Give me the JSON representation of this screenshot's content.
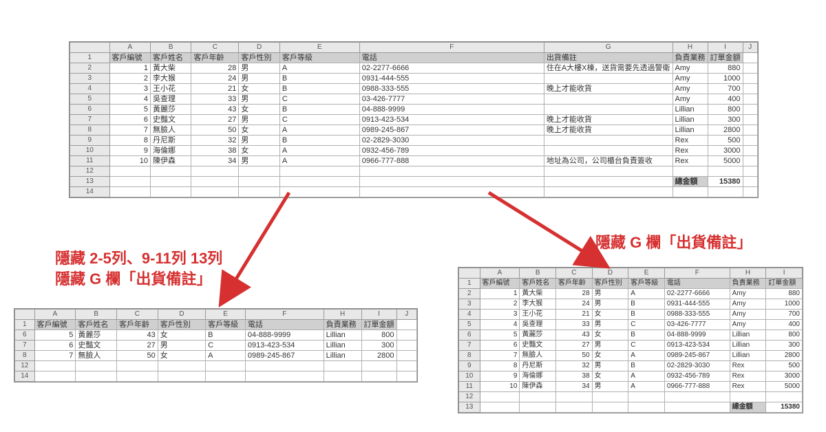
{
  "columns_full": [
    "A",
    "B",
    "C",
    "D",
    "E",
    "F",
    "G",
    "H",
    "I",
    "J"
  ],
  "columns_noG": [
    "A",
    "B",
    "C",
    "D",
    "E",
    "F",
    "H",
    "I",
    "J"
  ],
  "columns_noG2": [
    "A",
    "B",
    "C",
    "D",
    "E",
    "F",
    "H",
    "I"
  ],
  "headers_full": [
    "客戶編號",
    "客戶姓名",
    "客戶年齡",
    "客戶性別",
    "客戶等級",
    "電話",
    "出貨備註",
    "負責業務",
    "訂單金額",
    ""
  ],
  "headers_noG": [
    "客戶編號",
    "客戶姓名",
    "客戶年齡",
    "客戶性別",
    "客戶等級",
    "電話",
    "負責業務",
    "訂單金額",
    ""
  ],
  "headers_noG2": [
    "客戶編號",
    "客戶姓名",
    "客戶年齡",
    "客戶性別",
    "客戶等級",
    "電話",
    "負責業務",
    "訂單金額"
  ],
  "top_rows": [
    {
      "n": "2",
      "id": "1",
      "name": "黃大柴",
      "age": "28",
      "sex": "男",
      "grade": "A",
      "phone": "02-2277-6666",
      "note": "住在A大樓X棟，送貨需要先透過警衛",
      "rep": "Amy",
      "amt": "880"
    },
    {
      "n": "3",
      "id": "2",
      "name": "李大猴",
      "age": "24",
      "sex": "男",
      "grade": "B",
      "phone": "0931-444-555",
      "note": "",
      "rep": "Amy",
      "amt": "1000"
    },
    {
      "n": "4",
      "id": "3",
      "name": "王小花",
      "age": "21",
      "sex": "女",
      "grade": "B",
      "phone": "0988-333-555",
      "note": "晚上才能收貨",
      "rep": "Amy",
      "amt": "700"
    },
    {
      "n": "5",
      "id": "4",
      "name": "吳查理",
      "age": "33",
      "sex": "男",
      "grade": "C",
      "phone": "03-426-7777",
      "note": "",
      "rep": "Amy",
      "amt": "400"
    },
    {
      "n": "6",
      "id": "5",
      "name": "黃麗莎",
      "age": "43",
      "sex": "女",
      "grade": "B",
      "phone": "04-888-9999",
      "note": "",
      "rep": "Lillian",
      "amt": "800"
    },
    {
      "n": "7",
      "id": "6",
      "name": "史豔文",
      "age": "27",
      "sex": "男",
      "grade": "C",
      "phone": "0913-423-534",
      "note": "晚上才能收貨",
      "rep": "Lillian",
      "amt": "300"
    },
    {
      "n": "8",
      "id": "7",
      "name": "無臉人",
      "age": "50",
      "sex": "女",
      "grade": "A",
      "phone": "0989-245-867",
      "note": "晚上才能收貨",
      "rep": "Lillian",
      "amt": "2800"
    },
    {
      "n": "9",
      "id": "8",
      "name": "丹尼斯",
      "age": "32",
      "sex": "男",
      "grade": "B",
      "phone": "02-2829-3030",
      "note": "",
      "rep": "Rex",
      "amt": "500"
    },
    {
      "n": "10",
      "id": "9",
      "name": "海倫娜",
      "age": "38",
      "sex": "女",
      "grade": "A",
      "phone": "0932-456-789",
      "note": "",
      "rep": "Rex",
      "amt": "3000"
    },
    {
      "n": "11",
      "id": "10",
      "name": "陳伊森",
      "age": "34",
      "sex": "男",
      "grade": "A",
      "phone": "0966-777-888",
      "note": "地址為公司，公司櫃台負責簽收",
      "rep": "Rex",
      "amt": "5000"
    }
  ],
  "total_label": "總金額",
  "total_value": "15380",
  "annot_left_l1": "隱藏 2-5列、9-11列 13列",
  "annot_left_l2": "隱藏 G 欄「出貨備註」",
  "annot_right": "隱藏 G 欄「出貨備註」",
  "left_rows": [
    {
      "n": "6",
      "id": "5",
      "name": "黃麗莎",
      "age": "43",
      "sex": "女",
      "grade": "B",
      "phone": "04-888-9999",
      "rep": "Lillian",
      "amt": "800"
    },
    {
      "n": "7",
      "id": "6",
      "name": "史豔文",
      "age": "27",
      "sex": "男",
      "grade": "C",
      "phone": "0913-423-534",
      "rep": "Lillian",
      "amt": "300"
    },
    {
      "n": "8",
      "id": "7",
      "name": "無臉人",
      "age": "50",
      "sex": "女",
      "grade": "A",
      "phone": "0989-245-867",
      "rep": "Lillian",
      "amt": "2800"
    }
  ],
  "left_tail": [
    "12",
    "14"
  ],
  "right_rows": [
    {
      "n": "2",
      "id": "1",
      "name": "黃大柴",
      "age": "28",
      "sex": "男",
      "grade": "A",
      "phone": "02-2277-6666",
      "rep": "Amy",
      "amt": "880"
    },
    {
      "n": "3",
      "id": "2",
      "name": "李大猴",
      "age": "24",
      "sex": "男",
      "grade": "B",
      "phone": "0931-444-555",
      "rep": "Amy",
      "amt": "1000"
    },
    {
      "n": "4",
      "id": "3",
      "name": "王小花",
      "age": "21",
      "sex": "女",
      "grade": "B",
      "phone": "0988-333-555",
      "rep": "Amy",
      "amt": "700"
    },
    {
      "n": "5",
      "id": "4",
      "name": "吳查理",
      "age": "33",
      "sex": "男",
      "grade": "C",
      "phone": "03-426-7777",
      "rep": "Amy",
      "amt": "400"
    },
    {
      "n": "6",
      "id": "5",
      "name": "黃麗莎",
      "age": "43",
      "sex": "女",
      "grade": "B",
      "phone": "04-888-9999",
      "rep": "Lillian",
      "amt": "800"
    },
    {
      "n": "7",
      "id": "6",
      "name": "史豔文",
      "age": "27",
      "sex": "男",
      "grade": "C",
      "phone": "0913-423-534",
      "rep": "Lillian",
      "amt": "300"
    },
    {
      "n": "8",
      "id": "7",
      "name": "無臉人",
      "age": "50",
      "sex": "女",
      "grade": "A",
      "phone": "0989-245-867",
      "rep": "Lillian",
      "amt": "2800"
    },
    {
      "n": "9",
      "id": "8",
      "name": "丹尼斯",
      "age": "32",
      "sex": "男",
      "grade": "B",
      "phone": "02-2829-3030",
      "rep": "Rex",
      "amt": "500"
    },
    {
      "n": "10",
      "id": "9",
      "name": "海倫娜",
      "age": "38",
      "sex": "女",
      "grade": "A",
      "phone": "0932-456-789",
      "rep": "Rex",
      "amt": "3000"
    },
    {
      "n": "11",
      "id": "10",
      "name": "陳伊森",
      "age": "34",
      "sex": "男",
      "grade": "A",
      "phone": "0966-777-888",
      "rep": "Rex",
      "amt": "5000"
    }
  ]
}
